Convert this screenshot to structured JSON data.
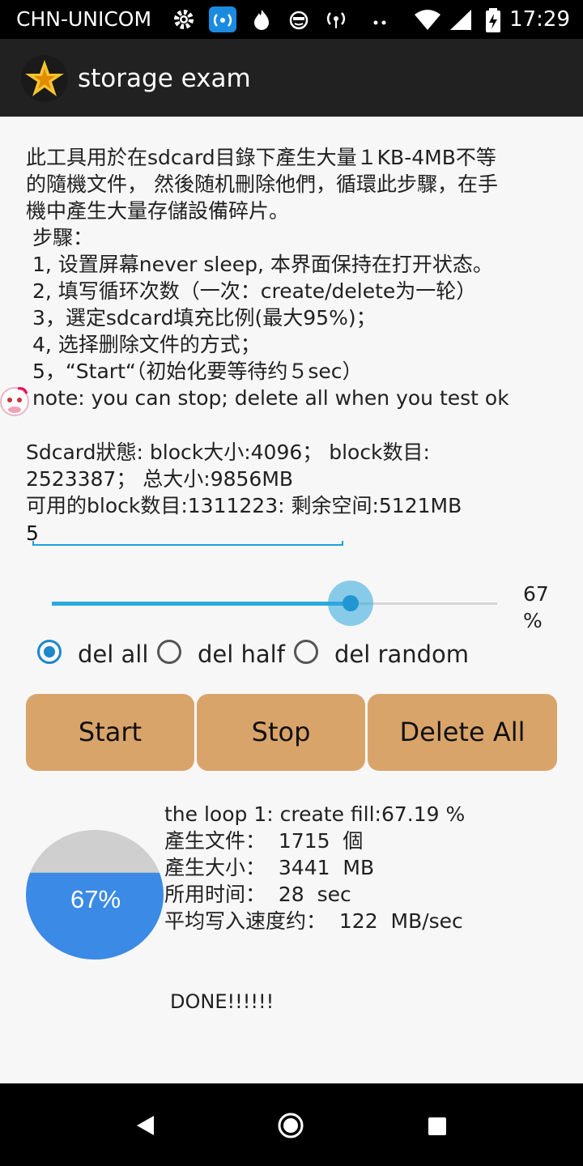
{
  "status_bar": {
    "carrier": "CHN-UNICOM",
    "time": "17:29",
    "icons": [
      "gear-icon",
      "wifi-hotspot-icon",
      "flame-icon",
      "face-icon",
      "signal-broadcast-icon",
      "more-dots-icon",
      "wifi-icon",
      "signal-icon",
      "battery-charging-icon"
    ]
  },
  "app_bar": {
    "title": "storage exam",
    "logo_icon": "star-logo-icon"
  },
  "description": {
    "lines": [
      "此工具用於在sdcard目錄下產生大量１KB-4MB不等",
      "的隨機文件， 然後随机刪除他們，循環此步驟，在手",
      "機中產生大量存儲設備碎片。",
      " 步驟：",
      " 1, 设置屏幕never sleep, 本界面保持在打开状态。",
      " 2, 填写循环次数（一次：create/delete为一轮）",
      " 3，選定sdcard填充比例(最大95%)；",
      " 4, 选择删除文件的方式；",
      " 5，“Start“（初始化要等待约５sec）",
      " note: you can stop; delete all when you test ok"
    ]
  },
  "sdcard": {
    "line1": "Sdcard狀態: block大小:4096； block数目:",
    "line2": "2523387； 总大小:9856MB",
    "line3": "可用的block数目:1311223: 剩余空间:5121MB"
  },
  "loop_input": {
    "value": "5"
  },
  "slider": {
    "value": 67,
    "max": 100,
    "value_label": "67",
    "unit_label": "%"
  },
  "delete_mode": {
    "options": [
      "del all",
      "del half",
      "del random"
    ],
    "selected": "del all"
  },
  "buttons": {
    "start": "Start",
    "stop": "Stop",
    "delete_all": "Delete All"
  },
  "progress": {
    "fill_percent": 67,
    "label": "67%"
  },
  "stats": {
    "line1": "the loop 1: create fill:67.19 %",
    "line2": "產生文件：  1715  個",
    "line3": "產生大小：  3441  MB",
    "line4": "所用时间：  28  sec",
    "line5": "平均写入速度约：  122  MB/sec"
  },
  "done_text": "DONE!!!!!!",
  "colors": {
    "accent": "#2ba8de",
    "button": "#d9a46a",
    "pie_fill": "#3b8ae6",
    "pie_empty": "#cfcfcf",
    "app_bar": "#212121"
  }
}
